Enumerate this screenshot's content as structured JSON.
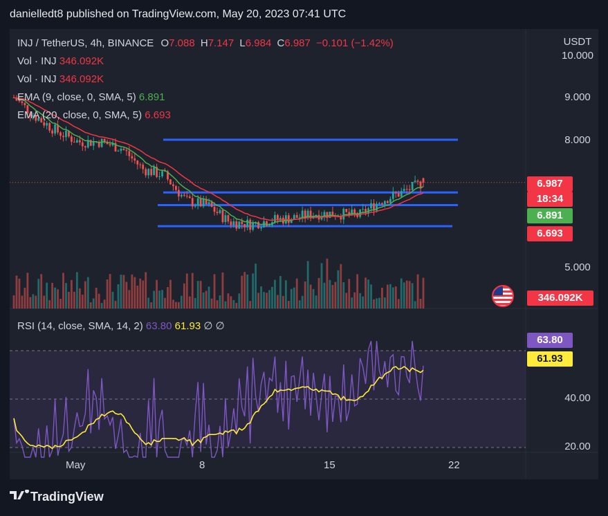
{
  "header": "danielledt8 published on TradingView.com, May 20, 2023 07:41 UTC",
  "legend": {
    "symbol": "INJ / TetherUS, 4h, BINANCE",
    "o_label": "O",
    "o_val": "7.088",
    "h_label": "H",
    "h_val": "7.147",
    "l_label": "L",
    "l_val": "6.984",
    "c_label": "C",
    "c_val": "6.987",
    "change": "−0.101 (−1.42%)",
    "vol1_label": "Vol · INJ",
    "vol1_val": "346.092K",
    "vol2_label": "Vol · INJ",
    "vol2_val": "346.092K",
    "ema9_label": "EMA (9, close, 0, SMA, 5)",
    "ema9_val": "6.891",
    "ema20_label": "EMA (20, close, 0, SMA, 5)",
    "ema20_val": "6.693",
    "rsi_label": "RSI (14, close, SMA, 14, 2)",
    "rsi_val": "63.80",
    "rsi_ma_val": "61.93",
    "rsi_extra": "∅ ∅"
  },
  "axis": {
    "currency": "USDT",
    "price_ticks": [
      "10.000",
      "9.000",
      "8.000",
      "5.000"
    ],
    "rsi_ticks": [
      "40.00",
      "20.00"
    ],
    "time_ticks": [
      "May",
      "8",
      "15",
      "22"
    ]
  },
  "tags": {
    "price": "6.987",
    "countdown": "18:34",
    "ema9": "6.891",
    "ema20": "6.693",
    "volume": "346.092K",
    "rsi": "63.80",
    "rsi_ma": "61.93"
  },
  "colors": {
    "up": "#26a69a",
    "down": "#ef5350",
    "ema9": "#4caf50",
    "ema20": "#f23645",
    "hlines": "#2962ff",
    "rsi": "#7e57c2",
    "rsi_ma": "#ffeb3b",
    "background": "#1e222d"
  },
  "footer": {
    "brand": "TradingView"
  },
  "chart_data": [
    {
      "type": "candlestick",
      "title": "INJ / TetherUS, 4h, BINANCE",
      "y_axis": "USDT",
      "ylim": [
        4.4,
        10.0
      ],
      "x_ticks": [
        "May",
        "8",
        "15",
        "22"
      ],
      "close_path": [
        [
          "May 1",
          9.0
        ],
        [
          "May 2",
          8.55
        ],
        [
          "May 3",
          8.2
        ],
        [
          "May 4",
          7.95
        ],
        [
          "May 5",
          7.95
        ],
        [
          "May 6",
          7.8
        ],
        [
          "May 7",
          7.3
        ],
        [
          "May 8",
          7.15
        ],
        [
          "May 9",
          6.55
        ],
        [
          "May 10",
          6.45
        ],
        [
          "May 11",
          6.05
        ],
        [
          "May 12",
          6.0
        ],
        [
          "May 13",
          6.1
        ],
        [
          "May 14",
          6.15
        ],
        [
          "May 15",
          6.25
        ],
        [
          "May 16",
          6.25
        ],
        [
          "May 17",
          6.2
        ],
        [
          "May 18",
          6.55
        ],
        [
          "May 19",
          6.75
        ],
        [
          "May 20",
          6.987
        ]
      ],
      "last": {
        "open": 7.088,
        "high": 7.147,
        "low": 6.984,
        "close": 6.987,
        "change": -0.101,
        "change_pct": -1.42
      },
      "indicators": {
        "ema9": 6.891,
        "ema20": 6.693,
        "volume": "346.092K"
      },
      "horizontal_lines": [
        8.0,
        6.75,
        6.45,
        5.95
      ],
      "grid": false
    },
    {
      "type": "line",
      "title": "RSI (14, close, SMA, 14, 2)",
      "ylim": [
        20,
        80
      ],
      "levels": [
        70,
        50,
        30
      ],
      "series": [
        {
          "name": "RSI",
          "last": 63.8
        },
        {
          "name": "RSI MA",
          "last": 61.93
        }
      ]
    }
  ]
}
